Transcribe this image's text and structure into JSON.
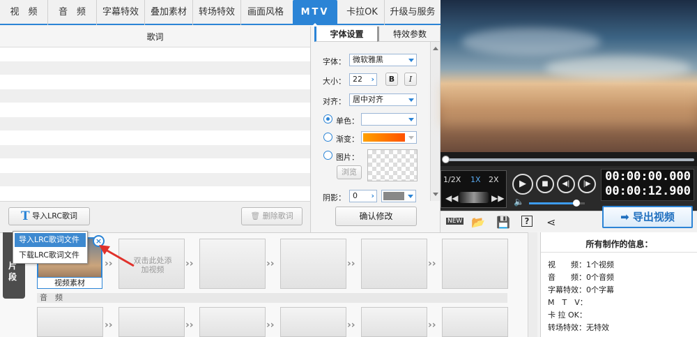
{
  "tabs": [
    {
      "label": "视　频"
    },
    {
      "label": "音　频"
    },
    {
      "label": "字幕特效"
    },
    {
      "label": "叠加素材"
    },
    {
      "label": "转场特效"
    },
    {
      "label": "画面风格"
    },
    {
      "label": "MTV",
      "active": true
    },
    {
      "label": "卡拉OK"
    },
    {
      "label": "升级与服务"
    }
  ],
  "lyrics": {
    "header": "歌词",
    "import_button": "导入LRC歌词",
    "delete_button": "删除歌词"
  },
  "popup": {
    "items": [
      "导入LRC歌词文件",
      "下载LRC歌词文件"
    ]
  },
  "settings": {
    "tabs": [
      "字体设置",
      "特效参数"
    ],
    "font_label": "字体：",
    "font_value": "微软雅黑",
    "size_label": "大小：",
    "size_value": "22",
    "bold": "B",
    "italic": "I",
    "align_label": "对齐：",
    "align_value": "居中对齐",
    "mono_label": "单色：",
    "gradient_label": "渐变：",
    "image_label": "图片：",
    "browse_button": "浏览",
    "shadow_label": "阴影：",
    "shadow_value": "0",
    "confirm_button": "确认修改"
  },
  "player": {
    "speeds": [
      "1/2X",
      "1X",
      "2X"
    ],
    "active_speed": "1X",
    "time_current": "00:00:00.000",
    "time_total": "00:00:12.900",
    "volume_level": 0.85,
    "new_badge": "NEW"
  },
  "export_button": "导出视频",
  "timeline": {
    "side_tab": "片段",
    "clip_label": "视频素材",
    "add_hint": "双击此处添加视频",
    "audio_label": "音　频"
  },
  "info": {
    "title": "所有制作的信息：",
    "rows": [
      {
        "k": "视　　频：",
        "v": "1个视频"
      },
      {
        "k": "音　　频：",
        "v": "0个音频"
      },
      {
        "k": "字幕特效：",
        "v": "0个字幕"
      },
      {
        "k": "M　T　V：",
        "v": ""
      },
      {
        "k": "卡 拉 OK：",
        "v": ""
      },
      {
        "k": "转场特效：",
        "v": "无特效"
      }
    ]
  },
  "colors": {
    "accent": "#2b84d6",
    "gradient_start": "#ffa100",
    "gradient_end": "#ff5200"
  }
}
